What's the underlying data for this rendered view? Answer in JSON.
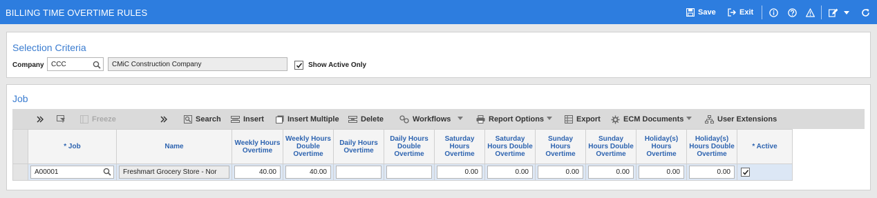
{
  "header": {
    "title": "BILLING TIME OVERTIME RULES",
    "save_label": "Save",
    "exit_label": "Exit"
  },
  "selection": {
    "title": "Selection Criteria",
    "company_label": "Company",
    "company_value": "CCC",
    "company_name": "CMiC Construction Company",
    "show_active_label": "Show Active Only",
    "show_active_checked": true
  },
  "job_panel": {
    "title": "Job",
    "toolbar": {
      "freeze": "Freeze",
      "search": "Search",
      "insert": "Insert",
      "insert_multiple": "Insert Multiple",
      "delete": "Delete",
      "workflows": "Workflows",
      "report_options": "Report Options",
      "export": "Export",
      "ecm_documents": "ECM Documents",
      "user_extensions": "User Extensions"
    },
    "columns": [
      "* Job",
      "Name",
      "Weekly Hours Overtime",
      "Weekly Hours Double Overtime",
      "Daily Hours Overtime",
      "Daily Hours Double Overtime",
      "Saturday Hours Overtime",
      "Saturday Hours Double Overtime",
      "Sunday Hours Overtime",
      "Sunday Hours Double Overtime",
      "Holiday(s) Hours Overtime",
      "Holiday(s) Hours Double Overtime",
      "* Active"
    ],
    "row": {
      "job": "A00001",
      "name": "Freshmart Grocery Store - Nor",
      "weekly_ot": "40.00",
      "weekly_dot": "40.00",
      "daily_ot": "",
      "daily_dot": "",
      "saturday_ot": "0.00",
      "saturday_dot": "0.00",
      "sunday_ot": "0.00",
      "sunday_dot": "0.00",
      "holiday_ot": "0.00",
      "holiday_dot": "0.00",
      "active": true
    }
  },
  "colors": {
    "header_bg": "#2d7ddf",
    "section_title": "#3a7cd0",
    "column_header_text": "#2e64b0",
    "row_highlight": "#dce7f5"
  }
}
